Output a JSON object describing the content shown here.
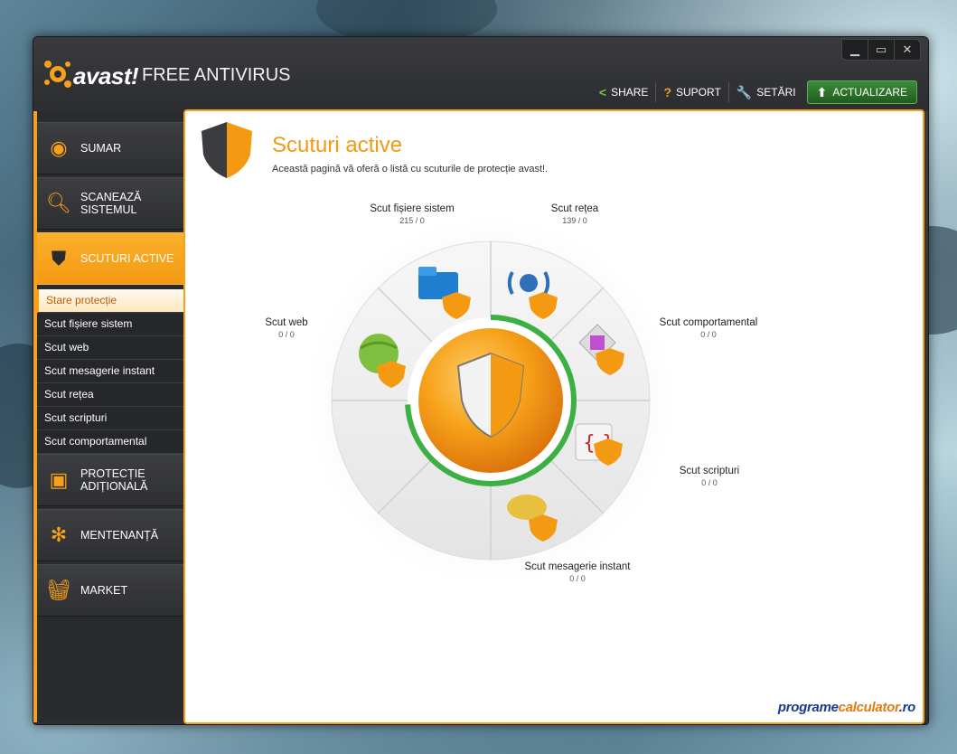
{
  "app": {
    "brand": "avast!",
    "product": "FREE ANTIVIRUS"
  },
  "window_controls": {
    "minimize": "▁",
    "maximize": "▭",
    "close": "✕"
  },
  "topnav": {
    "share": "SHARE",
    "support": "SUPORT",
    "settings": "SETĂRI",
    "update": "ACTUALIZARE",
    "icons": {
      "share": "share-icon",
      "support": "question-icon",
      "settings": "wrench-icon",
      "update": "up-arrow-icon"
    }
  },
  "sidebar": {
    "items": [
      {
        "label": "SUMAR",
        "icon": "eye-icon"
      },
      {
        "label": "SCANEAZĂ SISTEMUL",
        "icon": "magnifier-icon"
      },
      {
        "label": "SCUTURI ACTIVE",
        "icon": "shield-icon"
      },
      {
        "label": "PROTECȚIE ADIȚIONALĂ",
        "icon": "square-icon"
      },
      {
        "label": "MENTENANȚĂ",
        "icon": "gear-icon"
      },
      {
        "label": "MARKET",
        "icon": "basket-icon"
      }
    ],
    "sub_items": [
      "Stare protecție",
      "Scut fișiere sistem",
      "Scut web",
      "Scut mesagerie instant",
      "Scut rețea",
      "Scut scripturi",
      "Scut comportamental"
    ]
  },
  "main": {
    "title": "Scuturi active",
    "subtitle": "Această pagină vă oferă o listă cu scuturile de protecție avast!.",
    "shields": [
      {
        "name": "Scut fișiere sistem",
        "count": "215 / 0"
      },
      {
        "name": "Scut rețea",
        "count": "139 / 0"
      },
      {
        "name": "Scut web",
        "count": "0 / 0"
      },
      {
        "name": "Scut comportamental",
        "count": "0 / 0"
      },
      {
        "name": "Scut scripturi",
        "count": "0 / 0"
      },
      {
        "name": "Scut mesagerie instant",
        "count": "0 / 0"
      }
    ]
  },
  "watermark": {
    "part1": "programe",
    "part2": "calculator",
    "part3": ".ro"
  },
  "colors": {
    "accent": "#f7a11a",
    "update_green": "#2f7a2c",
    "ring_green": "#3cb043"
  }
}
